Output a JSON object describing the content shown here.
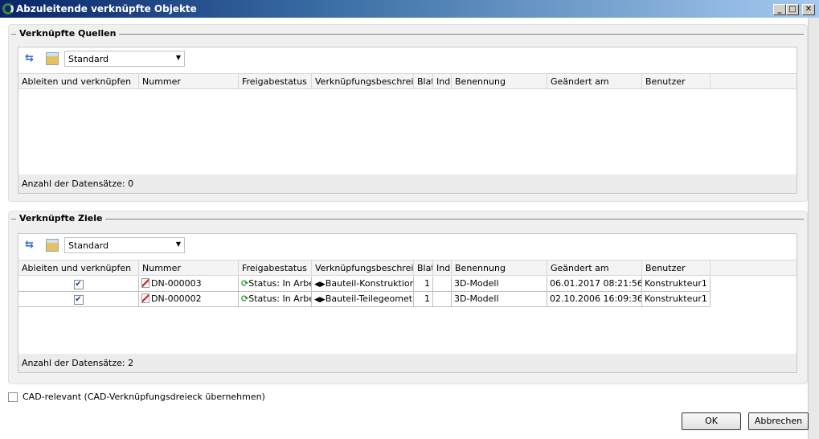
{
  "window": {
    "title": "Abzuleitende verknüpfte Objekte",
    "min": "_",
    "max": "□",
    "close": "✕"
  },
  "columns": [
    "Ableiten und verknüpfen",
    "Nummer",
    "Freigabestatus",
    "Verknüpfungsbeschreibu",
    "Blat",
    "Ind",
    "Benennung",
    "Geändert am",
    "Benutzer"
  ],
  "sources": {
    "title": "Verknüpfte Quellen",
    "view": "Standard",
    "count": "Anzahl der Datensätze: 0",
    "rows": []
  },
  "targets": {
    "title": "Verknüpfte Ziele",
    "view": "Standard",
    "count": "Anzahl der Datensätze: 2",
    "rows": [
      {
        "checked": true,
        "nummer": "DN-000003",
        "status": "Status: In Arbeit",
        "desc": "Bauteil-Konstruktion",
        "blatt": "1",
        "index": "",
        "benennung": "3D-Modell",
        "geaendert": "06.01.2017 08:21:56",
        "benutzer": "Konstrukteur1"
      },
      {
        "checked": true,
        "nummer": "DN-000002",
        "status": "Status: In Arbeit",
        "desc": "Bauteil-Teilegeometrie",
        "blatt": "1",
        "index": "",
        "benennung": "3D-Modell",
        "geaendert": "02.10.2006 16:09:36",
        "benutzer": "Konstrukteur1"
      }
    ]
  },
  "cad_relevant": {
    "label": "CAD-relevant (CAD-Verknüpfungsdreieck übernehmen)",
    "checked": false
  },
  "buttons": {
    "ok": "OK",
    "cancel": "Abbrechen"
  }
}
